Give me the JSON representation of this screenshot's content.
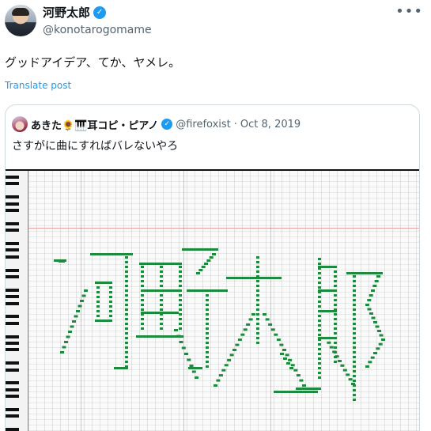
{
  "author": {
    "display_name": "河野太郎",
    "handle": "@konotarogomame",
    "verified_mark": "✓",
    "more_label": "•••"
  },
  "post": {
    "text": "グッドアイデア、てか、ヤメレ。",
    "translate_label": "Translate post"
  },
  "quoted": {
    "display_name": "あきた🌻🎹耳コピ・ピアノ",
    "verified_mark": "✓",
    "handle": "@firefoxist",
    "separator": "·",
    "date": "Oct 8, 2019",
    "text": "さすがに曲にすればバレないやろ"
  },
  "colors": {
    "accent": "#1d9bf0",
    "note_color": "#1e8a3e",
    "text_primary": "#0f1419",
    "text_secondary": "#536471"
  },
  "icons": {
    "verified": "verified-badge-icon",
    "more": "more-icon"
  }
}
